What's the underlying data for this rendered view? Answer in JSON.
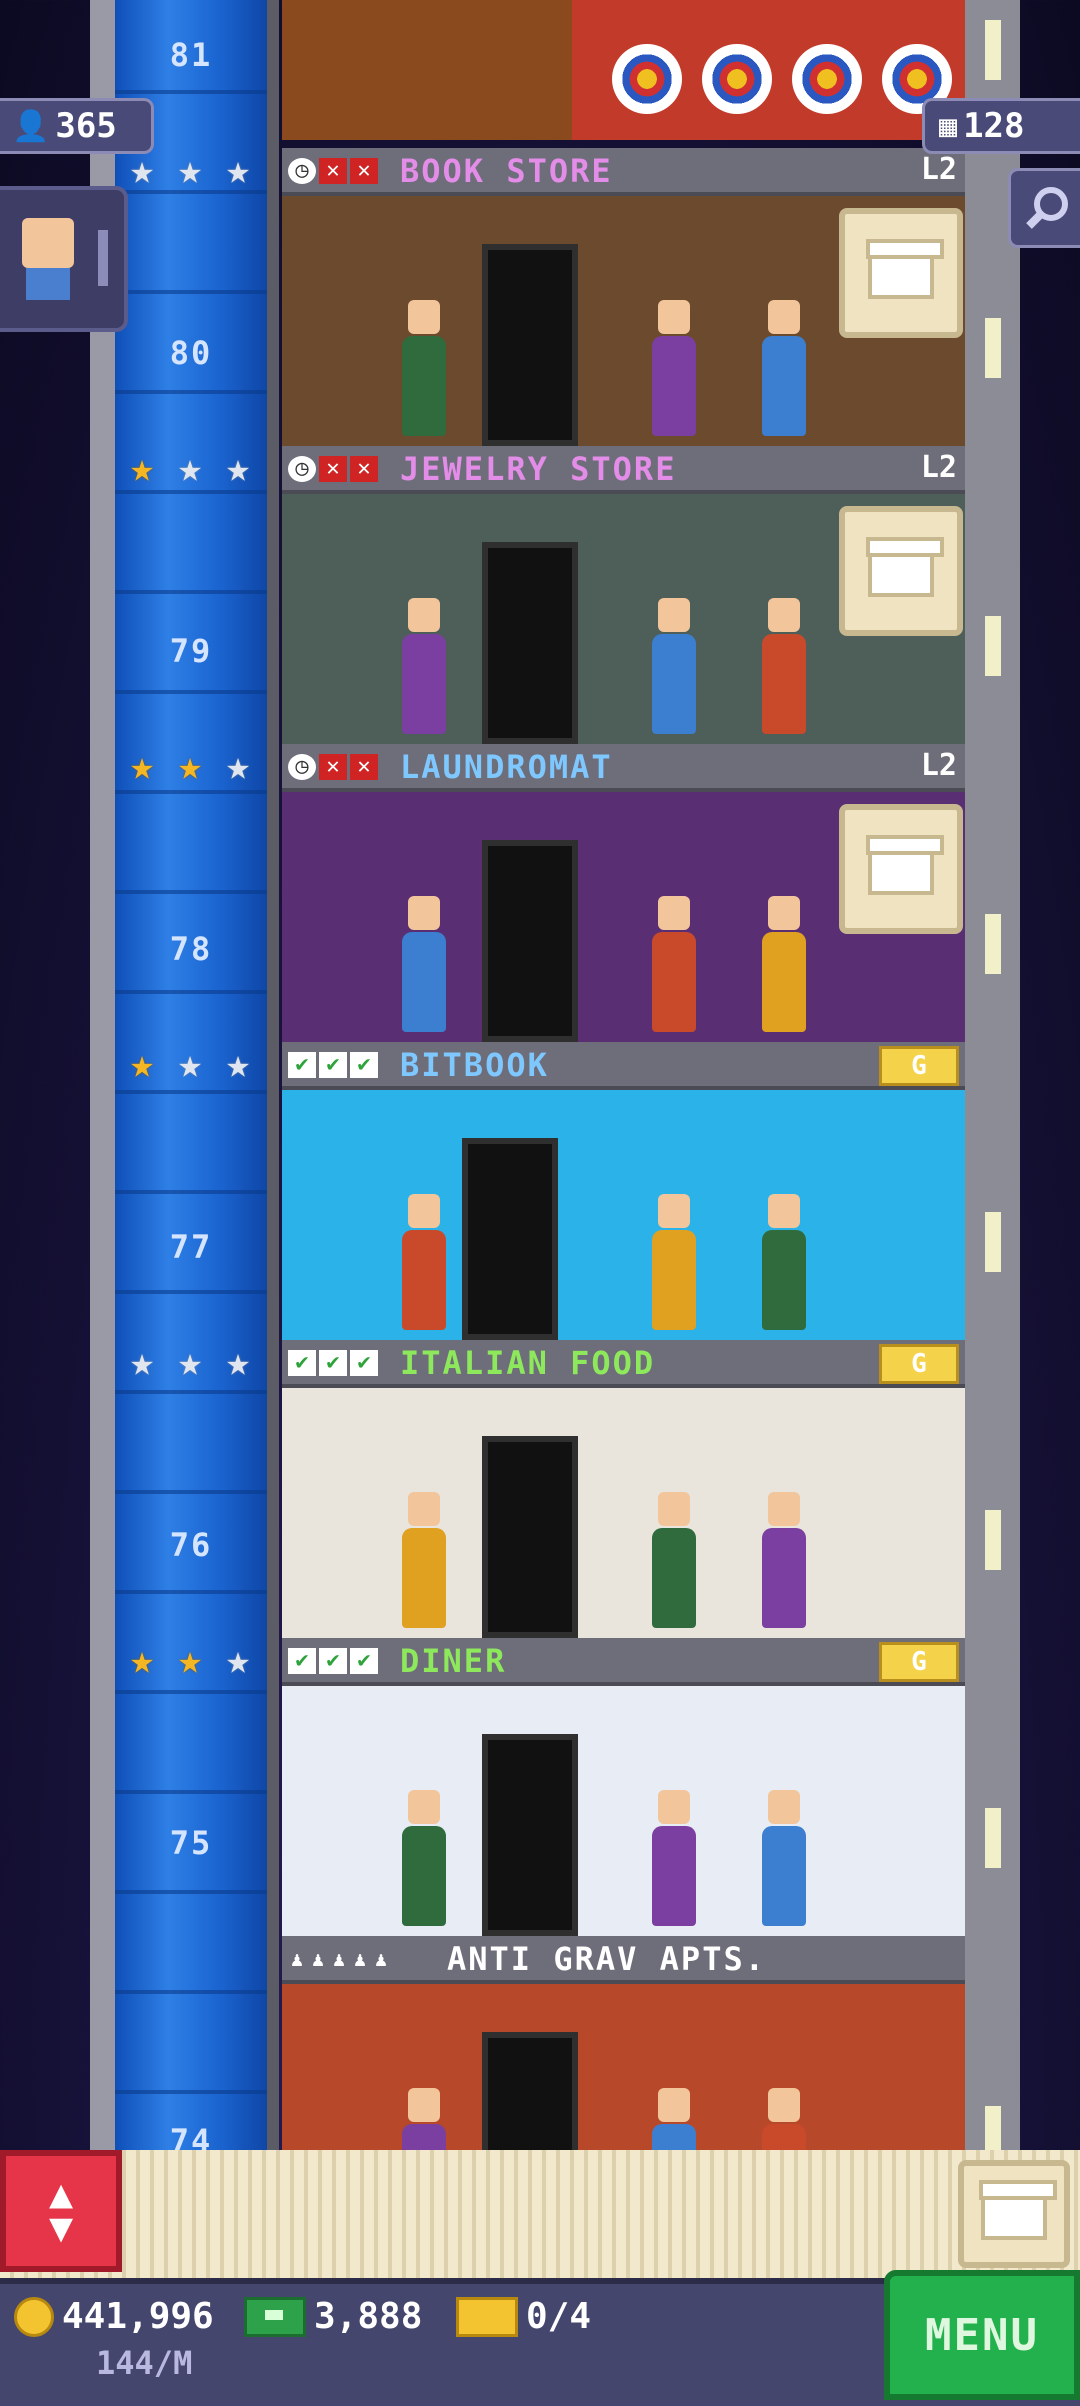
{
  "hud": {
    "population": "365",
    "floors_count": "128"
  },
  "tower": {
    "floor_numbers": [
      "81",
      "80",
      "79",
      "78",
      "77",
      "76",
      "75",
      "74"
    ],
    "floors": [
      {
        "name": "BOOK STORE",
        "level": "L2",
        "name_color": "#e38ce8",
        "status": [
          "clock",
          "x",
          "x"
        ],
        "stars": [
          0,
          0,
          0
        ],
        "badge": "stock",
        "room_bg": "#6b4a2e"
      },
      {
        "name": "JEWELRY STORE",
        "level": "L2",
        "name_color": "#e38ce8",
        "status": [
          "clock",
          "x",
          "x"
        ],
        "stars": [
          1,
          0,
          0
        ],
        "badge": "stock",
        "room_bg": "#4e5e58"
      },
      {
        "name": "LAUNDROMAT",
        "level": "L2",
        "name_color": "#7ec7ff",
        "status": [
          "clock",
          "x",
          "x"
        ],
        "stars": [
          1,
          1,
          0
        ],
        "badge": "stock",
        "room_bg": "#5a2e72"
      },
      {
        "name": "BITBOOK",
        "level": "G",
        "name_color": "#7ec7ff",
        "status": [
          "ok",
          "ok",
          "ok"
        ],
        "stars": [
          1,
          0,
          0
        ],
        "badge": "g",
        "room_bg": "#2bb2e8"
      },
      {
        "name": "ITALIAN FOOD",
        "level": "G",
        "name_color": "#8ee85c",
        "status": [
          "ok",
          "ok",
          "ok"
        ],
        "stars": [
          0,
          0,
          0
        ],
        "badge": "g",
        "room_bg": "#e9e4dc"
      },
      {
        "name": "DINER",
        "level": "G",
        "name_color": "#8ee85c",
        "status": [
          "ok",
          "ok",
          "ok"
        ],
        "stars": [
          1,
          1,
          0
        ],
        "badge": "g",
        "room_bg": "#e8edf5"
      },
      {
        "name": "ANTI GRAV APTS.",
        "level": "",
        "name_color": "#ffffff",
        "status": [],
        "stars": [],
        "badge": "none",
        "room_bg": "#b8482a"
      }
    ]
  },
  "bottom": {
    "coins": "441,996",
    "income": "144/M",
    "bux": "3,888",
    "tickets": "0/4",
    "menu_label": "MENU"
  },
  "colors": {
    "elevator": "#1f6fd8",
    "menu": "#22b14c",
    "updown": "#e63448",
    "star_on": "#f5b623"
  }
}
